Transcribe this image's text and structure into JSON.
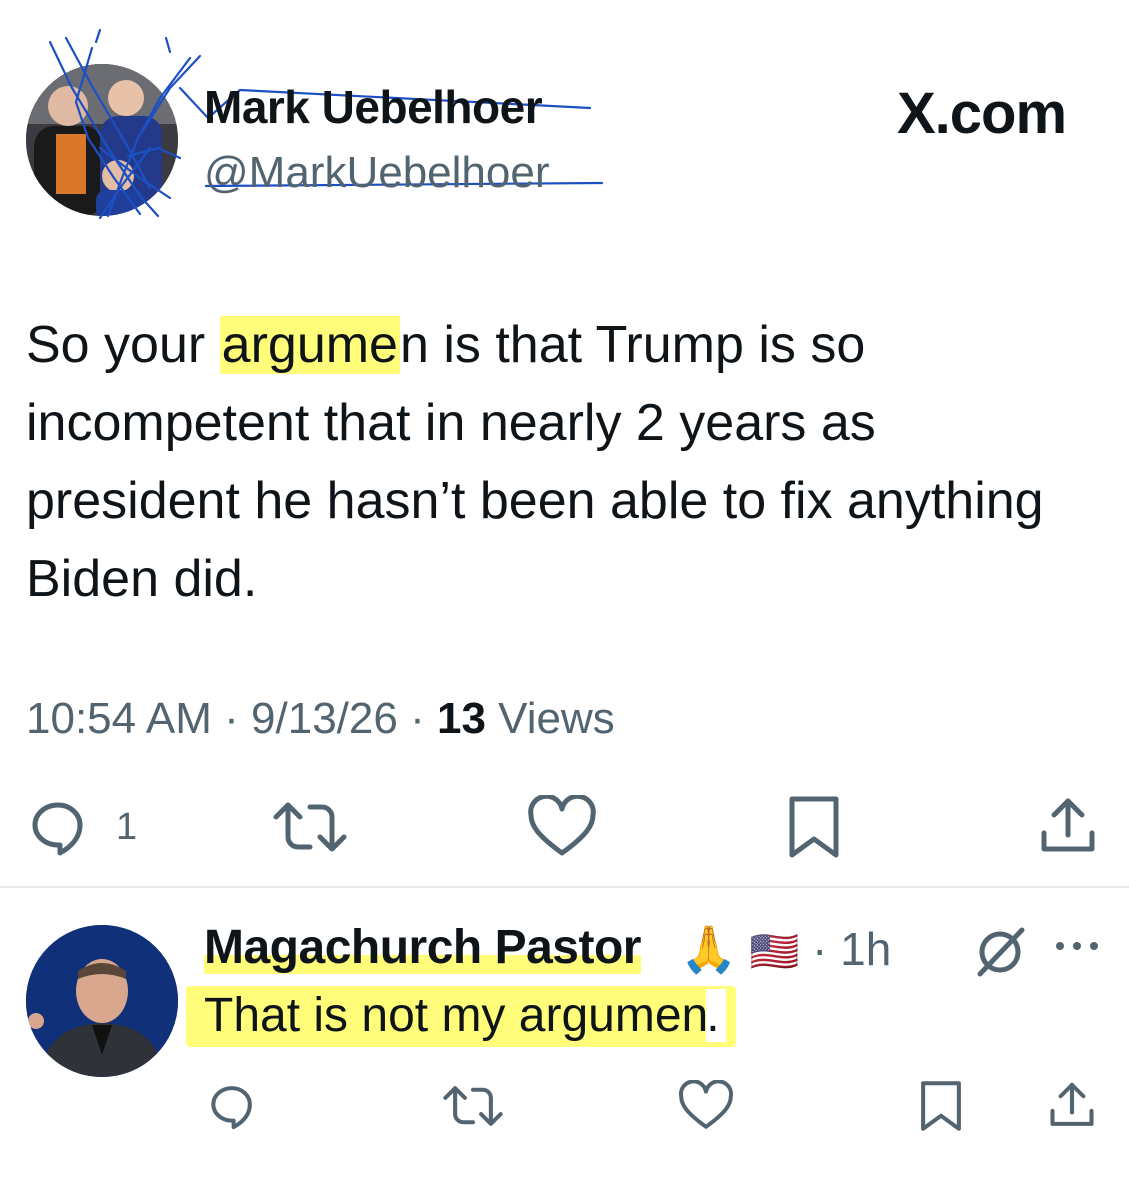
{
  "tweet": {
    "author_name": "Mark Uebelhoer",
    "author_handle": "@MarkUebelhoer",
    "brand": "X.com",
    "text_before": "So your ",
    "text_highlight": "argume",
    "text_after": "n is that Trump is so incompetent that in nearly 2 years as president he hasn’t been able to fix anything Biden did.",
    "time": "10:54 AM",
    "date": "9/13/26",
    "views_count": "13",
    "views_label": "Views",
    "separator": "·",
    "reply_count": "1",
    "icons": [
      "reply-icon",
      "retweet-icon",
      "like-icon",
      "bookmark-icon",
      "share-icon"
    ]
  },
  "reply": {
    "author_name": "Magachurch Pastor",
    "emoji": "🙏",
    "flag": "🇺🇸",
    "separator": "·",
    "time": "1h",
    "text_highlight": "That is not my argumen",
    "text_after": ".",
    "icons": [
      "grok-icon",
      "more-icon",
      "reply-icon",
      "retweet-icon",
      "like-icon",
      "bookmark-icon",
      "share-icon"
    ]
  },
  "colors": {
    "text": "#0f1419",
    "muted": "#536471",
    "highlight": "#fffd7a",
    "scribble": "#1d4fc4",
    "divider": "#e7e9ea"
  }
}
